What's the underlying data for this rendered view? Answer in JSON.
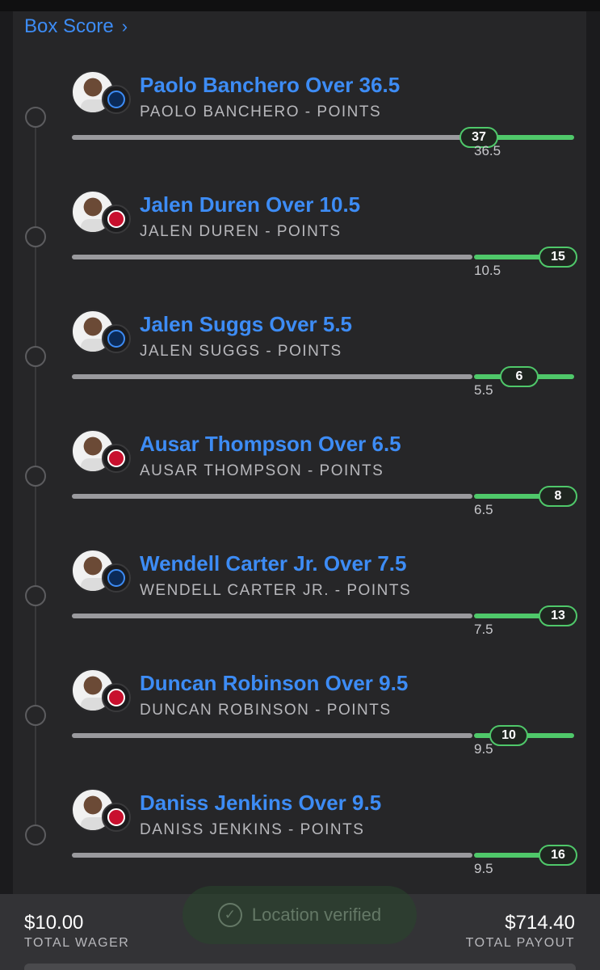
{
  "box_score": {
    "label": "Box Score",
    "chevron_icon": "chevron-right-icon"
  },
  "legs": [
    {
      "title": "Paolo Banchero Over 36.5",
      "subtitle": "PAOLO BANCHERO - POINTS",
      "line": "36.5",
      "actual": "37",
      "team_logo": "magic",
      "progress": 0.81
    },
    {
      "title": "Jalen Duren Over 10.5",
      "subtitle": "JALEN DUREN - POINTS",
      "line": "10.5",
      "actual": "15",
      "team_logo": "pistons",
      "progress": 1.0
    },
    {
      "title": "Jalen Suggs Over 5.5",
      "subtitle": "JALEN SUGGS - POINTS",
      "line": "5.5",
      "actual": "6",
      "team_logo": "magic",
      "progress": 0.89
    },
    {
      "title": "Ausar Thompson Over 6.5",
      "subtitle": "AUSAR THOMPSON - POINTS",
      "line": "6.5",
      "actual": "8",
      "team_logo": "pistons",
      "progress": 1.0
    },
    {
      "title": "Wendell Carter Jr. Over 7.5",
      "subtitle": "WENDELL CARTER JR. - POINTS",
      "line": "7.5",
      "actual": "13",
      "team_logo": "magic",
      "progress": 1.0
    },
    {
      "title": "Duncan Robinson Over 9.5",
      "subtitle": "DUNCAN ROBINSON - POINTS",
      "line": "9.5",
      "actual": "10",
      "team_logo": "pistons",
      "progress": 0.87
    },
    {
      "title": "Daniss Jenkins Over 9.5",
      "subtitle": "DANISS JENKINS - POINTS",
      "line": "9.5",
      "actual": "16",
      "team_logo": "pistons",
      "progress": 1.0
    }
  ],
  "location": {
    "label": "Location verified",
    "icon": "check-circle-icon"
  },
  "footer": {
    "wager_amount": "$10.00",
    "wager_label": "TOTAL WAGER",
    "payout_amount": "$714.40",
    "payout_label": "TOTAL PAYOUT"
  },
  "colors": {
    "accent": "#3d8cf5",
    "success": "#4fc86a",
    "background": "#1b1b1d",
    "card": "#262628"
  }
}
